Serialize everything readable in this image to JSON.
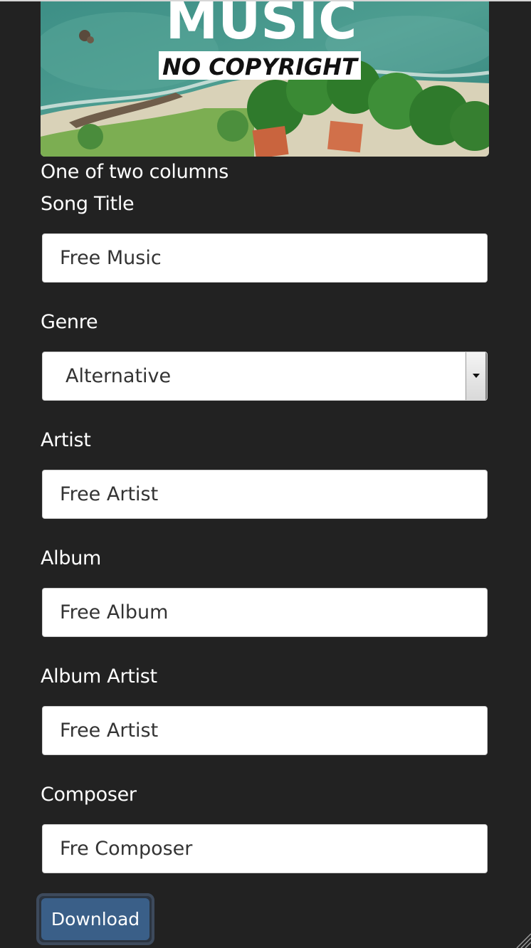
{
  "cover": {
    "title_text": "MUSIC",
    "subtitle_text": "NO COPYRIGHT"
  },
  "form": {
    "heading": "One of two columns",
    "fields": {
      "song_title": {
        "label": "Song Title",
        "value": "Free Music"
      },
      "genre": {
        "label": "Genre",
        "value": "Alternative"
      },
      "artist": {
        "label": "Artist",
        "value": "Free Artist"
      },
      "album": {
        "label": "Album",
        "value": "Free Album"
      },
      "album_artist": {
        "label": "Album Artist",
        "value": "Free Artist"
      },
      "composer": {
        "label": "Composer",
        "value": "Fre Composer"
      }
    },
    "download_label": "Download"
  },
  "colors": {
    "background": "#222222",
    "button": "#3a5f88",
    "text": "#ffffff"
  }
}
